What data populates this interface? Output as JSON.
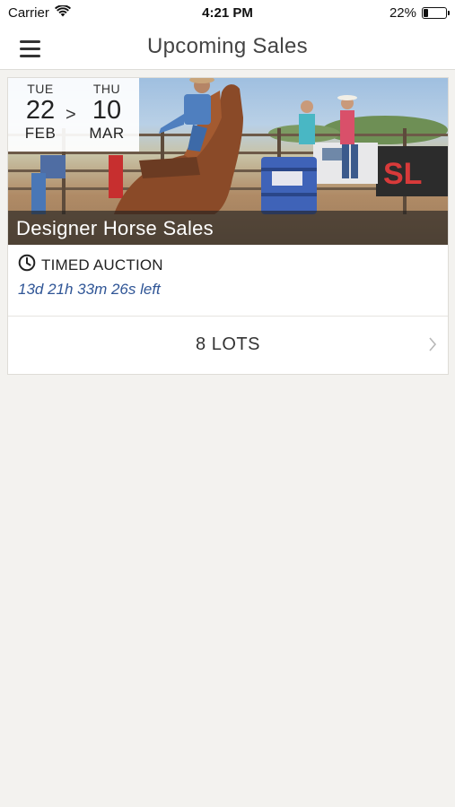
{
  "status_bar": {
    "carrier": "Carrier",
    "time": "4:21 PM",
    "battery_text": "22%",
    "battery_level": 0.22
  },
  "nav": {
    "title": "Upcoming Sales",
    "menu_icon": "hamburger-menu-icon"
  },
  "sales": [
    {
      "title": "Designer Horse Sales",
      "start": {
        "dow": "TUE",
        "day": "22",
        "month": "FEB"
      },
      "separator": ">",
      "end": {
        "dow": "THU",
        "day": "10",
        "month": "MAR"
      },
      "auction_type": "TIMED AUCTION",
      "time_left": "13d 21h 33m 26s left",
      "lots_label": "8 LOTS",
      "image_desc_icon": "barrel-racing-photo"
    }
  ]
}
